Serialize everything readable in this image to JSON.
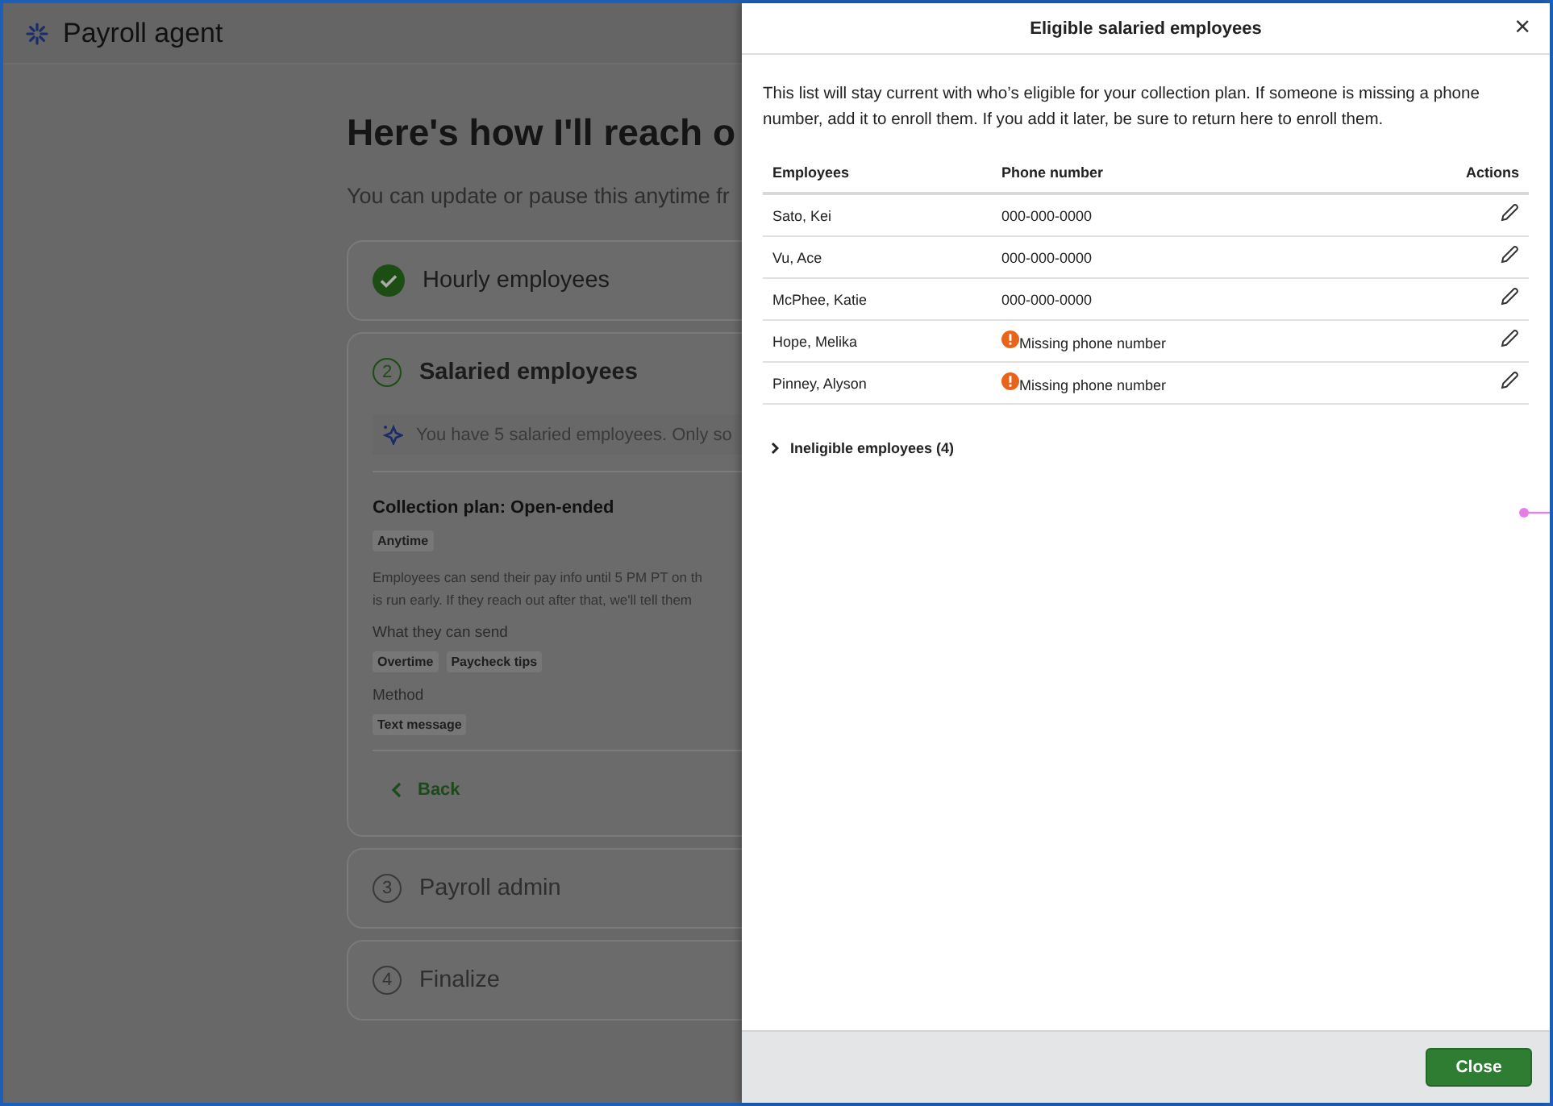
{
  "app": {
    "title": "Payroll agent"
  },
  "page": {
    "heading": "Here's how I'll reach o",
    "subtitle": "You can update or pause this anytime fr"
  },
  "steps": [
    {
      "title": "Hourly employees",
      "kind": "done"
    },
    {
      "number": "2",
      "title": "Salaried employees",
      "kind": "current",
      "notice": "You have 5 salaried employees. Only so",
      "plan_title": "Collection plan: Open-ended",
      "plan_tags": [
        "Anytime"
      ],
      "plan_text": [
        "Employees can send their pay info until 5 PM PT on th",
        "is run early. If they reach out after that, we'll tell them"
      ],
      "sections": [
        {
          "label": "What they can send",
          "tags": [
            "Overtime",
            "Paycheck tips"
          ]
        },
        {
          "label": "Method",
          "tags": [
            "Text message"
          ]
        }
      ],
      "back": "Back"
    },
    {
      "number": "3",
      "title": "Payroll admin",
      "kind": "upcoming"
    },
    {
      "number": "4",
      "title": "Finalize",
      "kind": "upcoming"
    }
  ],
  "drawer": {
    "title": "Eligible salaried employees",
    "close_icon": "×",
    "description": "This list will stay current with who’s eligible for your collection plan. If someone is missing a phone number, add it to enroll them. If you add it later, be sure to return here to enroll them.",
    "columns": [
      "Employees",
      "Phone number",
      "Actions"
    ],
    "rows": [
      {
        "name": "Sato, Kei",
        "phone": "000-000-0000",
        "missing": false
      },
      {
        "name": "Vu, Ace",
        "phone": "000-000-0000",
        "missing": false
      },
      {
        "name": "McPhee, Katie",
        "phone": "000-000-0000",
        "missing": false
      },
      {
        "name": "Hope, Melika",
        "phone": "Missing phone number",
        "missing": true
      },
      {
        "name": "Pinney, Alyson",
        "phone": "Missing phone number",
        "missing": true
      }
    ],
    "ineligible": {
      "label": "Ineligible employees (4)",
      "expanded": false
    },
    "footer_button": "Close"
  }
}
